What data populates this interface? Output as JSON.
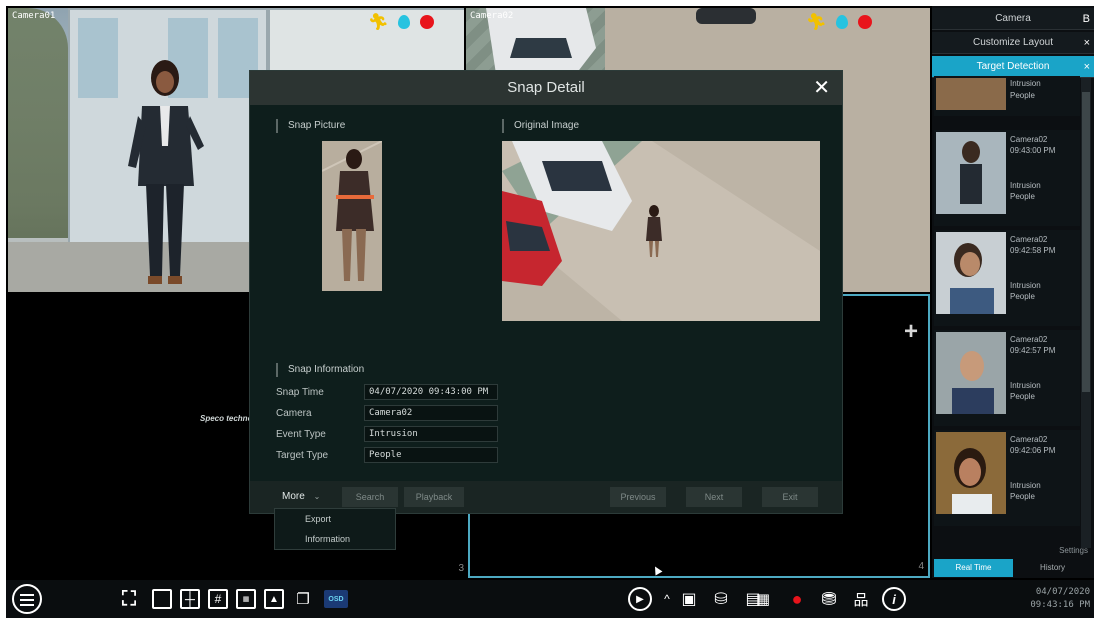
{
  "cameras": {
    "cam1_label": "Camera01",
    "cam2_label": "Camera02",
    "tile3_num": "3",
    "tile4_num": "4",
    "watermark": "Speco technologies"
  },
  "right_panel": {
    "camera_row": "Camera",
    "camera_row_extra": "B",
    "customize_layout": "Customize Layout",
    "target_detection": "Target Detection",
    "close_glyph": "×",
    "items": [
      {
        "camera": "",
        "time": "",
        "event": "Intrusion",
        "target": "People"
      },
      {
        "camera": "Camera02",
        "time": "09:43:00 PM",
        "event": "Intrusion",
        "target": "People"
      },
      {
        "camera": "Camera02",
        "time": "09:42:58 PM",
        "event": "Intrusion",
        "target": "People"
      },
      {
        "camera": "Camera02",
        "time": "09:42:57 PM",
        "event": "Intrusion",
        "target": "People"
      },
      {
        "camera": "Camera02",
        "time": "09:42:06 PM",
        "event": "Intrusion",
        "target": "People"
      }
    ],
    "settings": "Settings",
    "tab_realtime": "Real Time",
    "tab_history": "History"
  },
  "dialog": {
    "title": "Snap Detail",
    "close_glyph": "✕",
    "snap_picture_title": "Snap Picture",
    "original_image_title": "Original Image",
    "snap_info_title": "Snap Information",
    "fields": {
      "snap_time_label": "Snap Time",
      "snap_time_value": "04/07/2020 09:43:00 PM",
      "camera_label": "Camera",
      "camera_value": "Camera02",
      "event_type_label": "Event Type",
      "event_type_value": "Intrusion",
      "target_type_label": "Target Type",
      "target_type_value": "People"
    },
    "buttons": {
      "more": "More",
      "search": "Search",
      "playback": "Playback",
      "previous": "Previous",
      "next": "Next",
      "exit": "Exit"
    },
    "more_menu": [
      "Export",
      "Information"
    ]
  },
  "toolbar": {
    "osd_label": "OSD",
    "date": "04/07/2020",
    "time": "09:43:16 PM"
  },
  "colors": {
    "accent": "#1aa4c8",
    "dialog_bg": "#0e1e1c",
    "record": "#e8141b"
  }
}
